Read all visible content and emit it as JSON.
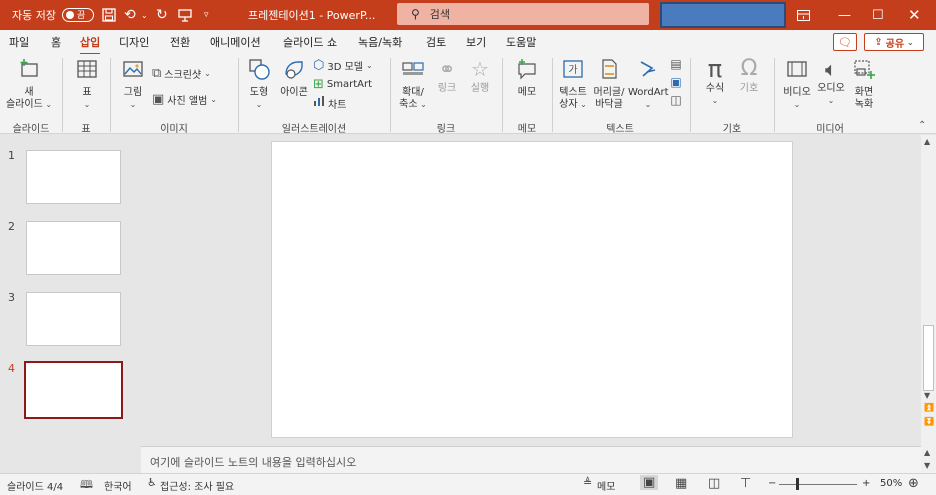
{
  "titlebar": {
    "autosave_label": "자동 저장",
    "autosave_state": "끔",
    "doc_title": "프레젠테이션1 - PowerP...",
    "search_icon": "magnifier-icon",
    "search_placeholder": "검색"
  },
  "menu": {
    "tabs": [
      "파일",
      "홈",
      "삽입",
      "디자인",
      "전환",
      "애니메이션",
      "슬라이드 쇼",
      "녹음/녹화",
      "검토",
      "보기",
      "도움말"
    ],
    "active_tab": "삽입",
    "share_label": "공유"
  },
  "ribbon": {
    "groups": {
      "slide": "슬라이드",
      "table": "표",
      "images": "이미지",
      "illustrations": "일러스트레이션",
      "links": "링크",
      "comments": "메모",
      "text": "텍스트",
      "symbols": "기호",
      "media": "미디어"
    },
    "new_slide": [
      "새",
      "슬라이드"
    ],
    "table": "표",
    "picture": "그림",
    "screenshot": "스크린샷",
    "photo_album": "사진 앨범",
    "shapes": "도형",
    "icons": "아이콘",
    "models_3d": "3D 모델",
    "smartart": "SmartArt",
    "chart": "차트",
    "zoom": [
      "확대/",
      "축소"
    ],
    "link": "링크",
    "action": "실행",
    "comment": "메모",
    "textbox": [
      "텍스트",
      "상자"
    ],
    "header_footer": [
      "머리글/",
      "바닥글"
    ],
    "wordart": "WordArt",
    "equation": "수식",
    "symbol": "기호",
    "video": "비디오",
    "audio": "오디오",
    "screen_recording": [
      "화면",
      "녹화"
    ]
  },
  "slides": [
    "1",
    "2",
    "3",
    "4"
  ],
  "active_slide": "4",
  "notes_placeholder": "여기에 슬라이드 노트의 내용을 입력하십시오",
  "status": {
    "slide_counter": "슬라이드 4/4",
    "language": "한국어",
    "accessibility": "접근성: 조사 필요",
    "notes_button": "메모",
    "zoom_level": "50%"
  },
  "colors": {
    "accent": "#c43e1c",
    "active_thumb_border": "#8b1a1a"
  }
}
